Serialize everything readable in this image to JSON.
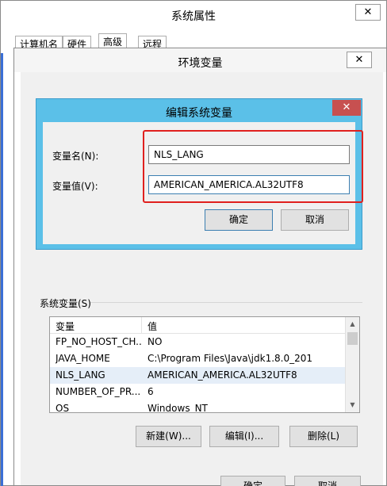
{
  "system_properties": {
    "title": "系统属性",
    "close_glyph": "✕",
    "tabs": [
      {
        "label": "计算机名"
      },
      {
        "label": "硬件"
      },
      {
        "label": "高级"
      },
      {
        "label": "远程"
      }
    ],
    "ok_label": "确定",
    "cancel_label": "取消"
  },
  "env_vars": {
    "title": "环境变量",
    "close_glyph": "✕",
    "system_vars_label": "系统变量(S)",
    "columns": {
      "name": "变量",
      "value": "值"
    },
    "rows": [
      {
        "name": "FP_NO_HOST_CH...",
        "value": "NO"
      },
      {
        "name": "JAVA_HOME",
        "value": "C:\\Program Files\\Java\\jdk1.8.0_201"
      },
      {
        "name": "NLS_LANG",
        "value": "AMERICAN_AMERICA.AL32UTF8"
      },
      {
        "name": "NUMBER_OF_PR...",
        "value": "6"
      },
      {
        "name": "OS",
        "value": "Windows_NT"
      }
    ],
    "new_label": "新建(W)...",
    "edit_label": "编辑(I)...",
    "delete_label": "删除(L)"
  },
  "edit_dialog": {
    "title": "编辑系统变量",
    "close_glyph": "✕",
    "name_label": "变量名(N):",
    "name_value": "NLS_LANG",
    "value_label": "变量值(V):",
    "value_value": "AMERICAN_AMERICA.AL32UTF8",
    "ok_label": "确定",
    "cancel_label": "取消"
  },
  "colors": {
    "dialog_frame": "#5bc0e8",
    "close_red": "#c75050",
    "highlight_box": "#e0201e",
    "selected_row": "#e5eef8"
  }
}
